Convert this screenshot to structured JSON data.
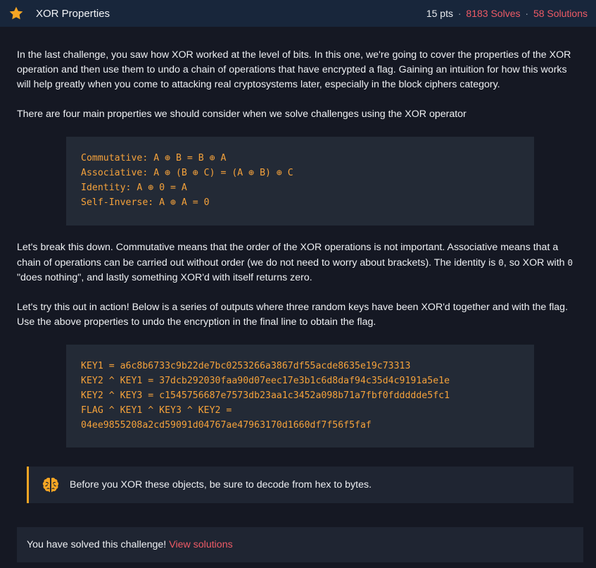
{
  "header": {
    "title": "XOR Properties",
    "points": "15 pts",
    "solves": "8183 Solves",
    "solutions": "58 Solutions",
    "separator": "·"
  },
  "intro": "In the last challenge, you saw how XOR worked at the level of bits. In this one, we're going to cover the properties of the XOR operation and then use them to undo a chain of operations that have encrypted a flag. Gaining an intuition for how this works will help greatly when you come to attacking real cryptosystems later, especially in the block ciphers category.",
  "properties_intro": "There are four main properties we should consider when we solve challenges using the XOR operator",
  "properties": [
    "Commutative: A ⊕ B = B ⊕ A",
    "Associative: A ⊕ (B ⊕ C) = (A ⊕ B) ⊕ C",
    "Identity: A ⊕ 0 = A",
    "Self-Inverse: A ⊕ A = 0"
  ],
  "breakdown": {
    "part1": "Let's break this down. Commutative means that the order of the XOR operations is not important. Associative means that a chain of operations can be carried out without order (we do not need to worry about brackets). The identity is ",
    "zero1": "0",
    "part2": ", so XOR with ",
    "zero2": "0",
    "part3": " \"does nothing\", and lastly something XOR'd with itself returns zero."
  },
  "action_text": "Let's try this out in action! Below is a series of outputs where three random keys have been XOR'd together and with the flag. Use the above properties to undo the encryption in the final line to obtain the flag.",
  "keys": [
    "KEY1 = a6c8b6733c9b22de7bc0253266a3867df55acde8635e19c73313",
    "KEY2 ^ KEY1 = 37dcb292030faa90d07eec17e3b1c6d8daf94c35d4c9191a5e1e",
    "KEY2 ^ KEY3 = c1545756687e7573db23aa1c3452a098b71a7fbf0fddddde5fc1",
    "FLAG ^ KEY1 ^ KEY3 ^ KEY2 =",
    "04ee9855208a2cd59091d04767ae47963170d1660df7f56f5faf"
  ],
  "hint": "Before you XOR these objects, be sure to decode from hex to bytes.",
  "solved": {
    "text": "You have solved this challenge!",
    "link": "View solutions"
  },
  "colors": {
    "accent_orange": "#f5a524",
    "accent_red": "#ef5b66",
    "code_text": "#f5a23b",
    "header_bg": "#18263b",
    "page_bg": "#151823"
  },
  "icons": [
    "star-icon",
    "brain-icon"
  ]
}
